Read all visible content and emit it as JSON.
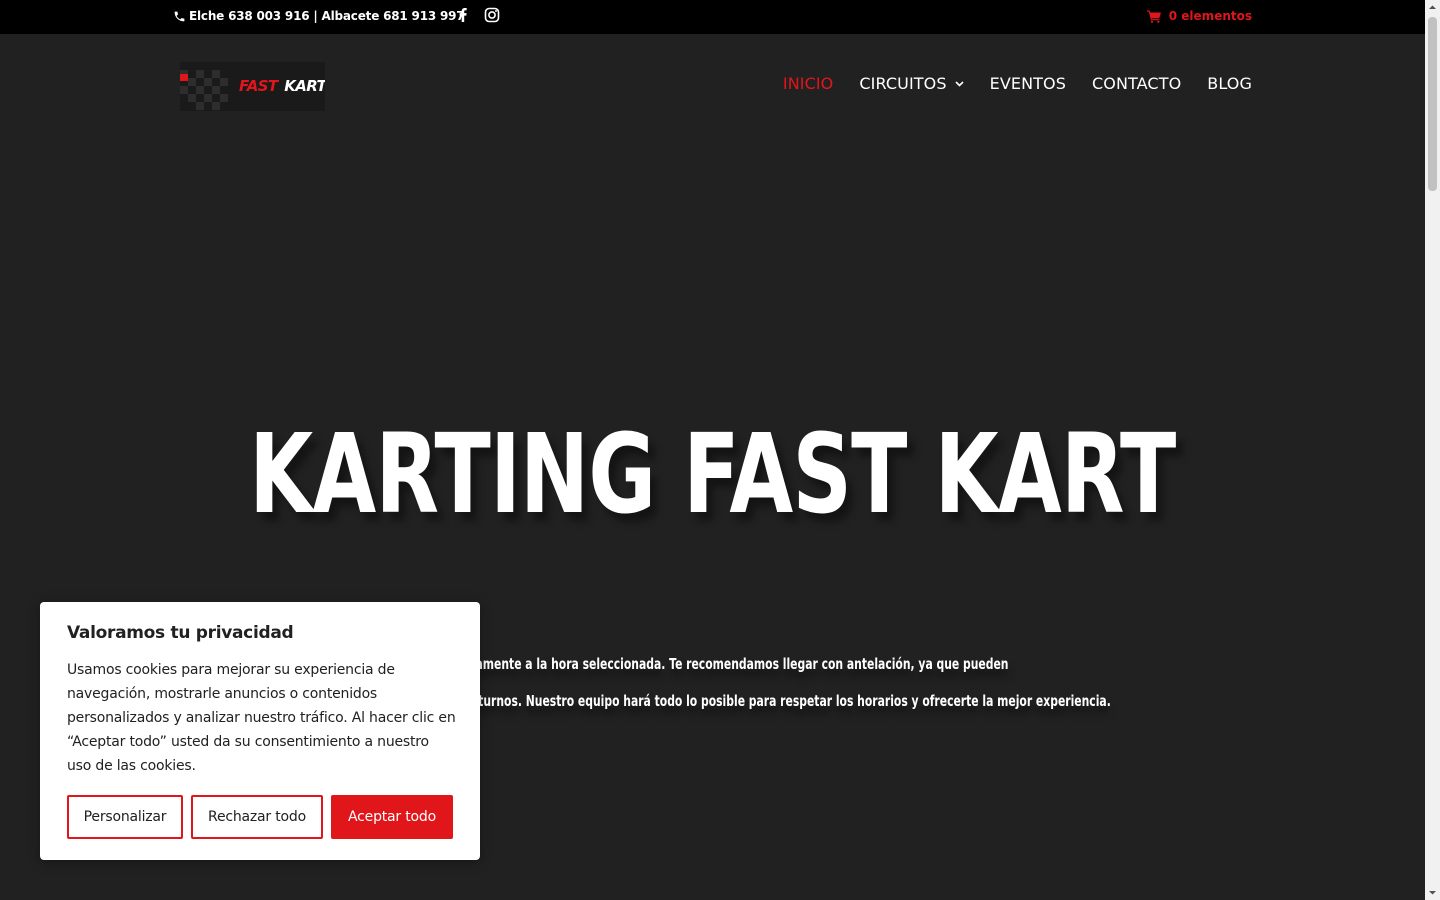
{
  "topbar": {
    "contact": "Elche 638 003 916 | Albacete 681 913 997",
    "cart": "0 elementos",
    "icons": [
      "phone-icon",
      "facebook-icon",
      "instagram-icon",
      "cart-icon"
    ]
  },
  "logo": {
    "text_fast": "FAST",
    "text_kart": "KART"
  },
  "nav": {
    "items": [
      {
        "label": "INICIO",
        "active": true
      },
      {
        "label": "CIRCUITOS",
        "has_dropdown": true
      },
      {
        "label": "EVENTOS"
      },
      {
        "label": "CONTACTO"
      },
      {
        "label": "BLOG"
      }
    ]
  },
  "hero": {
    "title": "KARTING FAST KART",
    "line1": "La reserva no garantiza que comiences exactamente a la hora seleccionada. Te recomendamos llegar con antelación, ya que pueden",
    "line2": "producirse cambios en la organización de los turnos. Nuestro equipo hará todo lo posible para respetar los horarios y ofrecerte la mejor experiencia."
  },
  "cookie": {
    "title": "Valoramos tu privacidad",
    "text": "Usamos cookies para mejorar su experiencia de navegación, mostrarle anuncios o contenidos personalizados y analizar nuestro tráfico. Al hacer clic en “Aceptar todo” usted da su consentimiento a nuestro uso de las cookies.",
    "buttons": {
      "customize": "Personalizar",
      "reject": "Rechazar todo",
      "accept": "Aceptar todo"
    }
  },
  "colors": {
    "accent": "#e0161b",
    "background": "#212121",
    "topbar": "#000000"
  }
}
